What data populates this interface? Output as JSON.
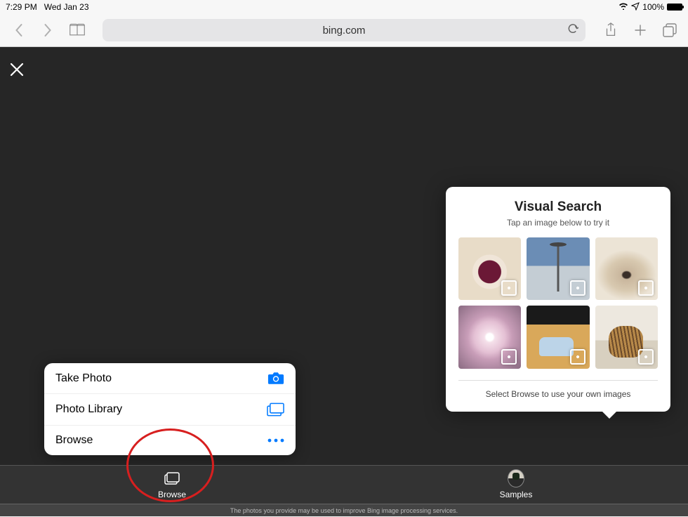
{
  "status_bar": {
    "time": "7:29 PM",
    "date": "Wed Jan 23",
    "battery_percent": "100%"
  },
  "browser": {
    "url": "bing.com"
  },
  "close_label": "Close",
  "action_sheet": {
    "items": [
      {
        "label": "Take Photo",
        "icon": "camera-icon"
      },
      {
        "label": "Photo Library",
        "icon": "stacked-rects-icon"
      },
      {
        "label": "Browse",
        "icon": "ellipsis-icon"
      }
    ]
  },
  "visual_search": {
    "title": "Visual Search",
    "subtitle": "Tap an image below to try it",
    "footer": "Select Browse to use your own images",
    "samples": [
      {
        "name": "sample-pie"
      },
      {
        "name": "sample-space-needle"
      },
      {
        "name": "sample-pug"
      },
      {
        "name": "sample-blossom"
      },
      {
        "name": "sample-sneakers"
      },
      {
        "name": "sample-cat"
      }
    ]
  },
  "bottom_tabs": {
    "browse": "Browse",
    "samples": "Samples"
  },
  "disclaimer": "The photos you provide may be used to improve Bing image processing services."
}
